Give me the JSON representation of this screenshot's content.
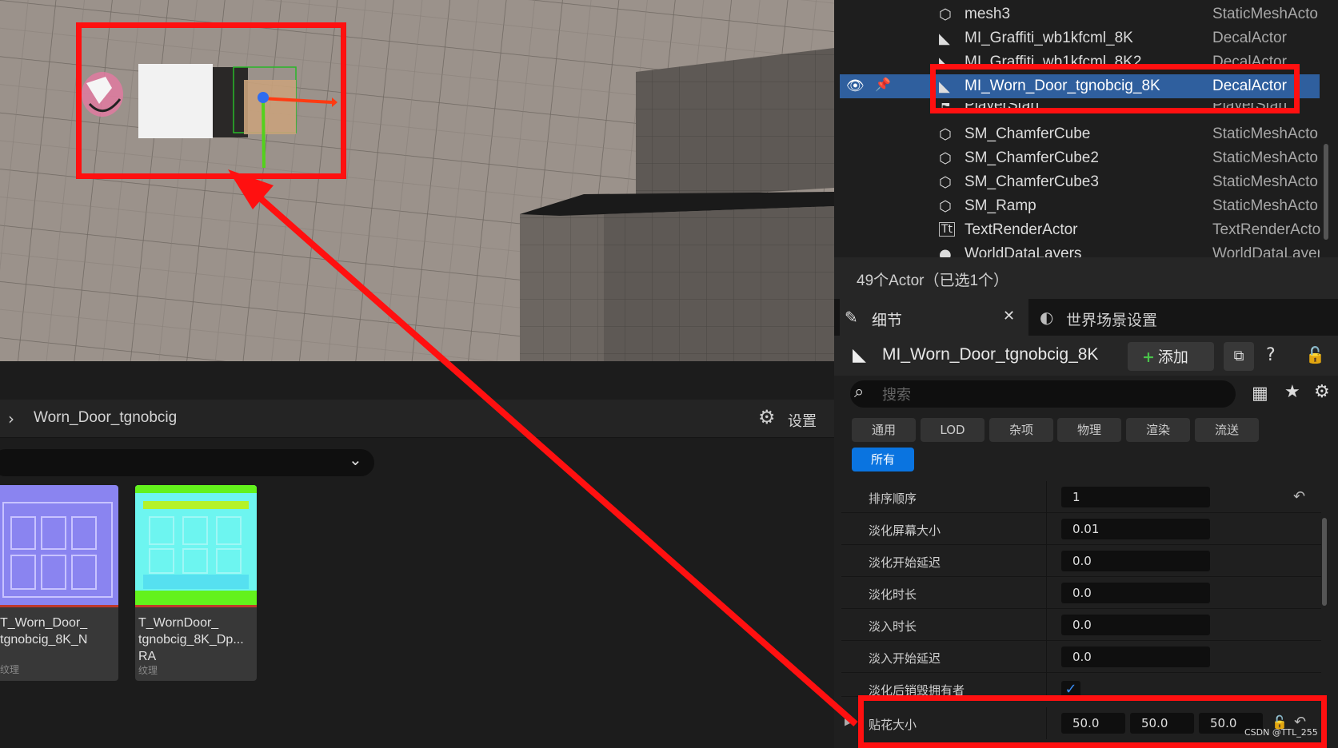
{
  "content_browser": {
    "path": "Worn_Door_tgnobcig",
    "settings_label": "设置",
    "assets": [
      {
        "name": "T_Worn_Door_\ntgnobcig_8K_N",
        "type": "纹理"
      },
      {
        "name": "T_WornDoor_\ntgnobcig_8K_Dp...\nRA",
        "type": "纹理"
      }
    ]
  },
  "outliner": {
    "rows": [
      {
        "name": "mesh3",
        "type": "StaticMeshActo",
        "icon": "static-mesh-icon"
      },
      {
        "name": "MI_Graffiti_wb1kfcml_8K",
        "type": "DecalActor",
        "icon": "decal-icon"
      },
      {
        "name": "MI_Graffiti_wb1kfcml_8K2",
        "type": "DecalActor",
        "icon": "decal-icon"
      },
      {
        "name": "MI_Worn_Door_tgnobcig_8K",
        "type": "DecalActor",
        "icon": "decal-icon"
      },
      {
        "name": "PlayerStart",
        "type": "PlayerStart",
        "icon": "player-start-icon"
      },
      {
        "name": "SM_ChamferCube",
        "type": "StaticMeshActo",
        "icon": "static-mesh-icon"
      },
      {
        "name": "SM_ChamferCube2",
        "type": "StaticMeshActo",
        "icon": "static-mesh-icon"
      },
      {
        "name": "SM_ChamferCube3",
        "type": "StaticMeshActo",
        "icon": "static-mesh-icon"
      },
      {
        "name": "SM_Ramp",
        "type": "StaticMeshActo",
        "icon": "static-mesh-icon"
      },
      {
        "name": "TextRenderActor",
        "type": "TextRenderActo",
        "icon": "text-render-icon"
      },
      {
        "name": "WorldDataLayers",
        "type": "WorldDataLayer",
        "icon": "world-icon"
      }
    ],
    "selected_index": 3,
    "status": "49个Actor（已选1个）"
  },
  "details": {
    "tab_details": "细节",
    "tab_world": "世界场景设置",
    "actor_name": "MI_Worn_Door_tgnobcig_8K",
    "add_label": "添加",
    "search_placeholder": "搜索",
    "filters": [
      "通用",
      "LOD",
      "杂项",
      "物理",
      "渲染",
      "流送",
      "所有"
    ],
    "active_filter": "所有",
    "properties": [
      {
        "label": "排序顺序",
        "value": "1"
      },
      {
        "label": "淡化屏幕大小",
        "value": "0.01"
      },
      {
        "label": "淡化开始延迟",
        "value": "0.0"
      },
      {
        "label": "淡化时长",
        "value": "0.0"
      },
      {
        "label": "淡入时长",
        "value": "0.0"
      },
      {
        "label": "淡入开始延迟",
        "value": "0.0"
      },
      {
        "label": "淡化后销毁拥有者",
        "value": ""
      }
    ],
    "decal_size": {
      "label": "贴花大小",
      "x": "50.0",
      "y": "50.0",
      "z": "50.0"
    }
  },
  "watermark": "CSDN @TTL_255",
  "colors": {
    "highlight": "#ff1010",
    "selection": "#2f5f9e",
    "accent": "#0a74e0"
  }
}
